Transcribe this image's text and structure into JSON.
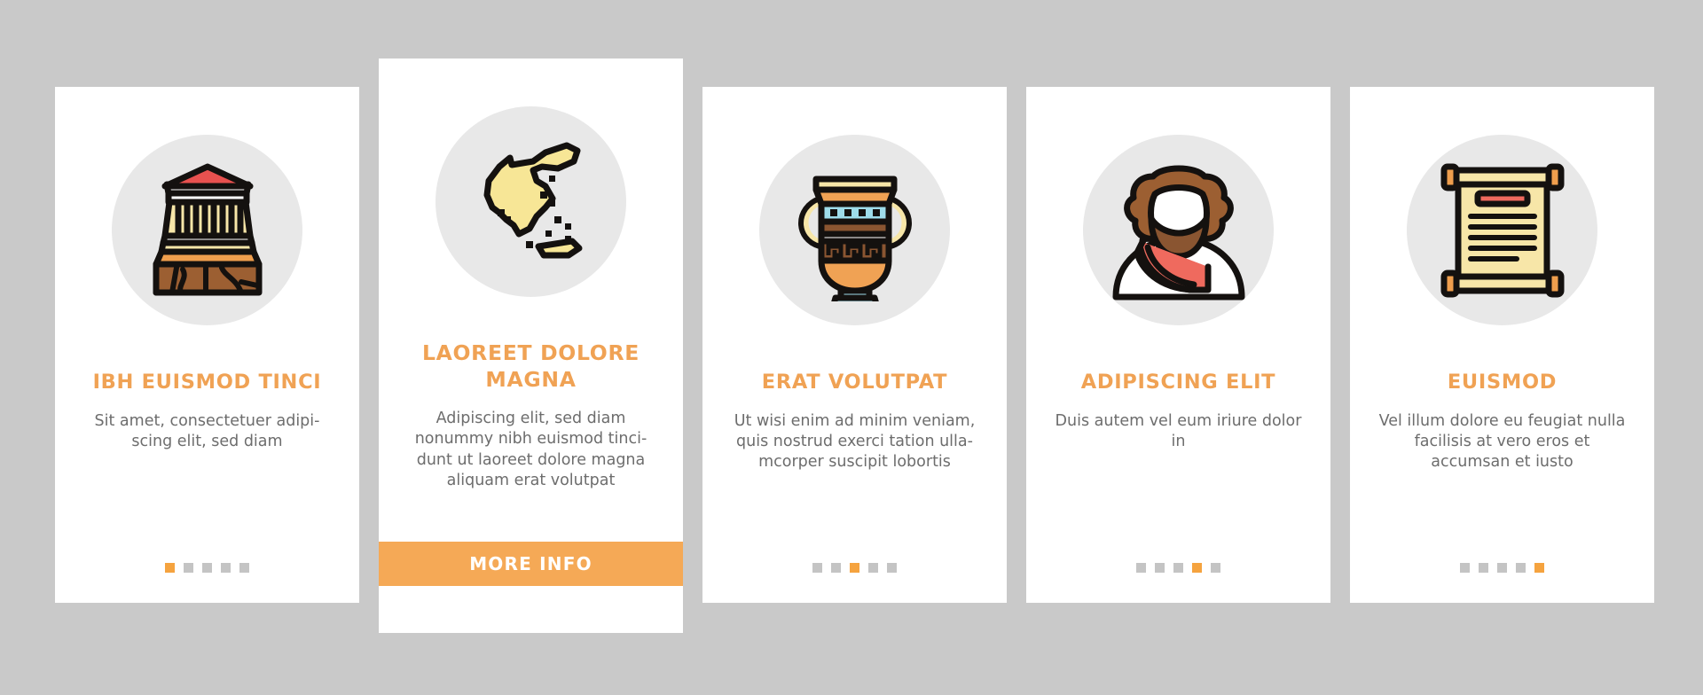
{
  "page": {
    "background_color": "#c9c9c9",
    "card_background": "#ffffff",
    "accent_color": "#f0a254",
    "button_color": "#f5a956",
    "dot_inactive_color": "#c4c4c4",
    "dot_active_color": "#f5a33f",
    "icon_circle_color": "#e8e8e8",
    "body_text_color": "#6d6d6d"
  },
  "cards": [
    {
      "id": "card-1",
      "featured": false,
      "icon_name": "parthenon-temple-icon",
      "title": "IBH EUISMOD TINCI",
      "description": "Sit amet, consectetuer adipi-scing elit, sed diam",
      "dots": {
        "count": 5,
        "active_index": 0
      },
      "button": null
    },
    {
      "id": "card-2",
      "featured": true,
      "icon_name": "greece-map-icon",
      "title": "LAOREET DOLORE MAGNA",
      "description": "Adipiscing elit, sed diam nonummy nibh euismod tinci-dunt ut laoreet dolore magna aliquam erat volutpat",
      "dots": null,
      "button": {
        "label": "MORE INFO"
      }
    },
    {
      "id": "card-3",
      "featured": false,
      "icon_name": "greek-amphora-vase-icon",
      "title": "ERAT VOLUTPAT",
      "description": "Ut wisi enim ad minim veniam, quis nostrud exerci tation ulla-mcorper suscipit lobortis",
      "dots": {
        "count": 5,
        "active_index": 2
      },
      "button": null
    },
    {
      "id": "card-4",
      "featured": false,
      "icon_name": "greek-philosopher-icon",
      "title": "ADIPISCING ELIT",
      "description": "Duis autem vel eum iriure dolor in",
      "dots": {
        "count": 5,
        "active_index": 3
      },
      "button": null
    },
    {
      "id": "card-5",
      "featured": false,
      "icon_name": "papyrus-scroll-icon",
      "title": "EUISMOD",
      "description": "Vel illum dolore eu feugiat nulla facilisis at vero eros et accumsan et iusto",
      "dots": {
        "count": 5,
        "active_index": 4
      },
      "button": null
    }
  ]
}
